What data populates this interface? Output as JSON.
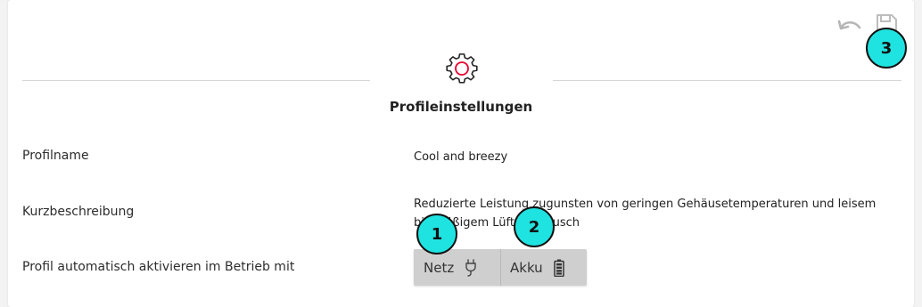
{
  "header": {
    "title": "Profileinstellungen",
    "icons": {
      "undo": "undo-icon",
      "save": "save-icon",
      "settings": "gear-icon"
    },
    "accent_color": "#e8002d"
  },
  "rows": {
    "name_label": "Profilname",
    "name_value": "Cool and breezy",
    "desc_label": "Kurzbeschreibung",
    "desc_value": "Reduzierte Leistung zugunsten von geringen Gehäusetemperaturen und leisem bis mäßigem Lüftergeräusch",
    "auto_label": "Profil automatisch aktivieren im Betrieb mit"
  },
  "power_toggle": {
    "options": [
      {
        "label": "Netz",
        "icon": "power-plug-icon"
      },
      {
        "label": "Akku",
        "icon": "battery-icon"
      }
    ]
  },
  "annotations": [
    "1",
    "2",
    "3"
  ],
  "colors": {
    "badge": "#1fe3e0",
    "toggle_bg": "#cfcfcf"
  }
}
